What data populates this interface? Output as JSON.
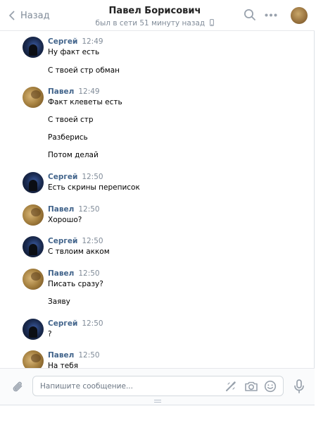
{
  "header": {
    "back_label": "Назад",
    "contact_name": "Павел Борисович",
    "status": "был в сети 51 минуту назад",
    "icons": [
      "chevron-left-icon",
      "search-icon",
      "more-icon",
      "avatar"
    ]
  },
  "messages": [
    {
      "author": "Сергей",
      "time": "12:49",
      "lines": [
        "Ну факт есть",
        "С твоей стр обман"
      ]
    },
    {
      "author": "Павел",
      "time": "12:49",
      "lines": [
        "Факт клеветы есть",
        "С твоей стр",
        "Разберись",
        "Потом делай"
      ]
    },
    {
      "author": "Сергей",
      "time": "12:50",
      "lines": [
        "Есть скрины переписок"
      ]
    },
    {
      "author": "Павел",
      "time": "12:50",
      "lines": [
        "Хорошо?"
      ]
    },
    {
      "author": "Сергей",
      "time": "12:50",
      "lines": [
        "С твлоим акком"
      ]
    },
    {
      "author": "Павел",
      "time": "12:50",
      "lines": [
        "Писать сразу?",
        "Заяву"
      ]
    },
    {
      "author": "Сергей",
      "time": "12:50",
      "lines": [
        "?"
      ]
    },
    {
      "author": "Павел",
      "time": "12:50",
      "lines": [
        "На тебя"
      ]
    }
  ],
  "composer": {
    "placeholder": "Напишите сообщение...",
    "icons": [
      "paperclip-icon",
      "graffiti-icon",
      "camera-icon",
      "smile-icon",
      "microphone-icon"
    ]
  },
  "colors": {
    "author_link": "#42648b",
    "muted": "#818c99",
    "icon": "#99a2ad"
  }
}
